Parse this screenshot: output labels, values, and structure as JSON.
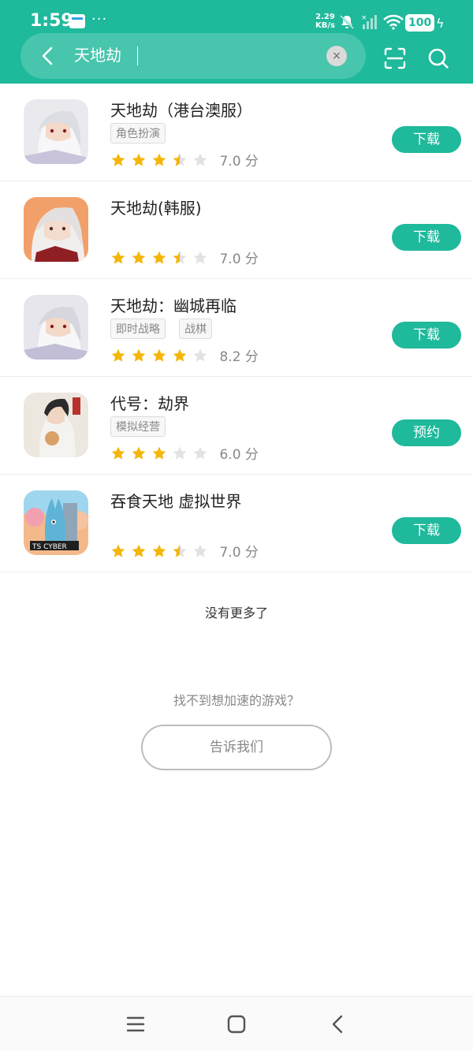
{
  "status_bar": {
    "time": "1:59",
    "extra": "···",
    "net_speed_value": "2.29",
    "net_speed_unit": "KB/s",
    "battery": "100"
  },
  "search": {
    "query": "天地劫",
    "clear_label": "×"
  },
  "colors": {
    "accent": "#1fb99c",
    "star": "#f5b60a",
    "star_empty": "#e2e2e2"
  },
  "results": [
    {
      "name": "天地劫（港台澳服）",
      "tags": [
        "角色扮演"
      ],
      "rating": 3.5,
      "score": "7.0 分",
      "action": "下载"
    },
    {
      "name": "天地劫(韩服)",
      "tags": [],
      "rating": 3.5,
      "score": "7.0 分",
      "action": "下载"
    },
    {
      "name": "天地劫：幽城再临",
      "tags": [
        "即时战略",
        "战棋"
      ],
      "rating": 4,
      "score": "8.2 分",
      "action": "下载"
    },
    {
      "name": "代号：劫界",
      "tags": [
        "模拟经营"
      ],
      "rating": 3,
      "score": "6.0 分",
      "action": "预约"
    },
    {
      "name": "吞食天地 虚拟世界",
      "tags": [],
      "rating": 3.5,
      "score": "7.0 分",
      "action": "下载",
      "icon_text": "TS CYBER"
    }
  ],
  "footer": {
    "no_more": "没有更多了",
    "cannot_find": "找不到想加速的游戏？",
    "tell_us": "告诉我们"
  }
}
